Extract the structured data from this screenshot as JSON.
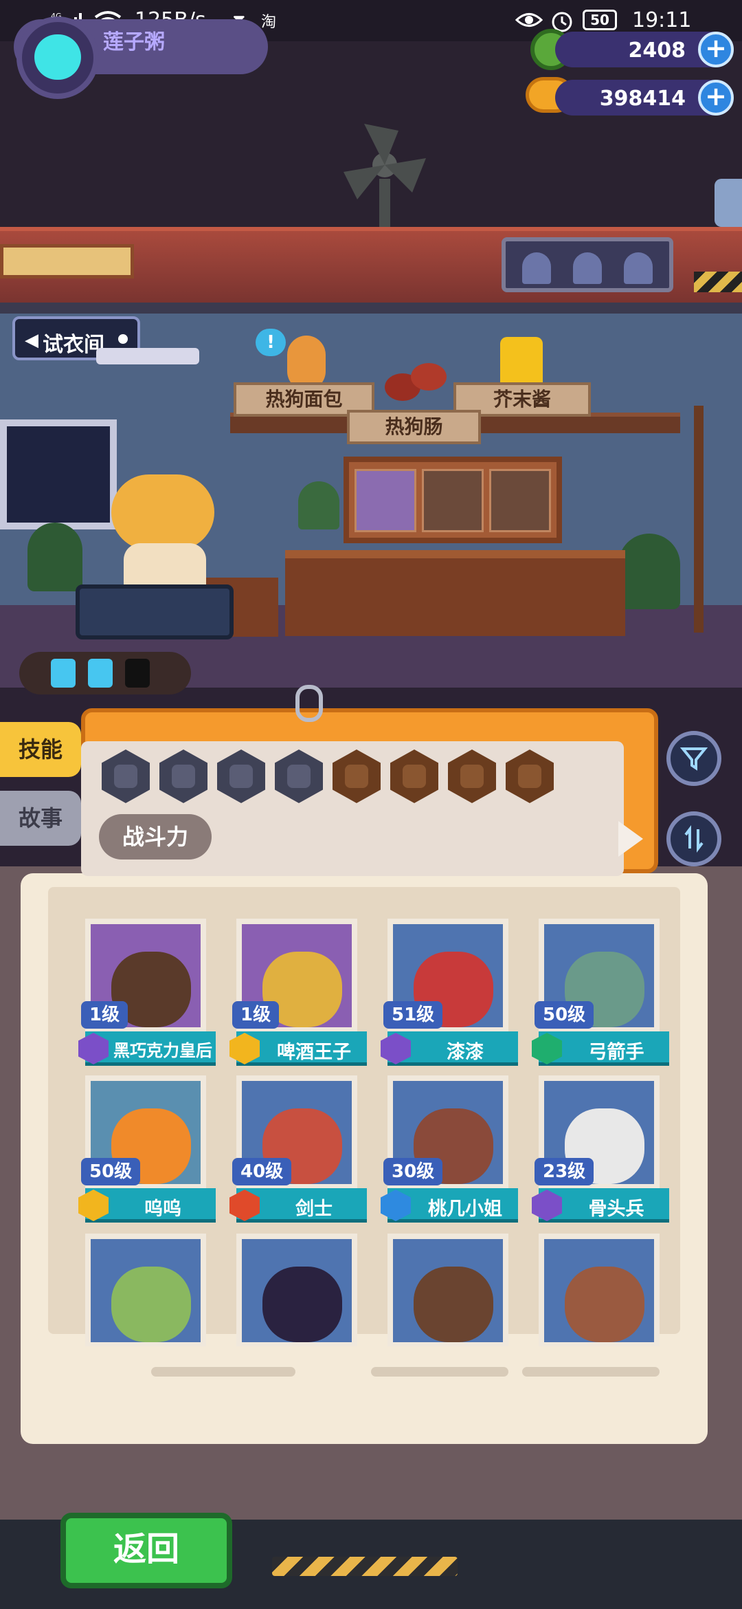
{
  "status_bar": {
    "network": "4G",
    "net_speed": "125B/s",
    "battery": "50",
    "time": "19:11",
    "taobao": "淘"
  },
  "player": {
    "name": "莲子粥"
  },
  "currencies": [
    {
      "icon": "gem-icon",
      "value": "2408"
    },
    {
      "icon": "coin-icon",
      "value": "398414"
    }
  ],
  "room": {
    "fitting_room_label": "试衣间",
    "ingredients": {
      "bun": "热狗面包",
      "sausage": "热狗肠",
      "mustard": "芥末酱"
    },
    "alert": "!"
  },
  "side_tabs": {
    "skill": "技能",
    "story": "故事"
  },
  "filter_panel": {
    "power_label": "战斗力",
    "role_filters": [
      "heart-icon",
      "bell-icon",
      "shield-icon",
      "anchor-icon"
    ],
    "tag_filters": [
      "hand-icon",
      "smile-icon",
      "muscle-icon",
      "brain-icon"
    ]
  },
  "characters": [
    {
      "level": "1级",
      "name": "黑巧克力皇后",
      "class_color": "#7b4fc8",
      "bg": "purple",
      "face": "#5a3a2a"
    },
    {
      "level": "1级",
      "name": "啤酒王子",
      "class_color": "#f2b51e",
      "bg": "purple",
      "face": "#e0b040"
    },
    {
      "level": "51级",
      "name": "漆漆",
      "class_color": "#7b4fc8",
      "bg": "blue",
      "face": "#c83a3a"
    },
    {
      "level": "50级",
      "name": "弓箭手",
      "class_color": "#1fae6e",
      "bg": "blue",
      "face": "#6a9a8a"
    },
    {
      "level": "50级",
      "name": "呜呜",
      "class_color": "#f2b51e",
      "bg": "teal",
      "face": "#f08a2a"
    },
    {
      "level": "40级",
      "name": "剑士",
      "class_color": "#e04a2a",
      "bg": "blue",
      "face": "#c85040"
    },
    {
      "level": "30级",
      "name": "桃几小姐",
      "class_color": "#2e8ae0",
      "bg": "blue",
      "face": "#8a4a3a"
    },
    {
      "level": "23级",
      "name": "骨头兵",
      "class_color": "#7b4fc8",
      "bg": "blue",
      "face": "#e8e8e8"
    },
    {
      "level": "",
      "name": "",
      "class_color": "#1fae6e",
      "bg": "blue",
      "face": "#8ab860"
    },
    {
      "level": "",
      "name": "",
      "class_color": "#7b4fc8",
      "bg": "blue",
      "face": "#2a2240"
    },
    {
      "level": "",
      "name": "",
      "class_color": "#f2b51e",
      "bg": "blue",
      "face": "#6a4430"
    },
    {
      "level": "",
      "name": "",
      "class_color": "#e04a2a",
      "bg": "blue",
      "face": "#9a5a40"
    }
  ],
  "bottom": {
    "back_label": "返回"
  }
}
